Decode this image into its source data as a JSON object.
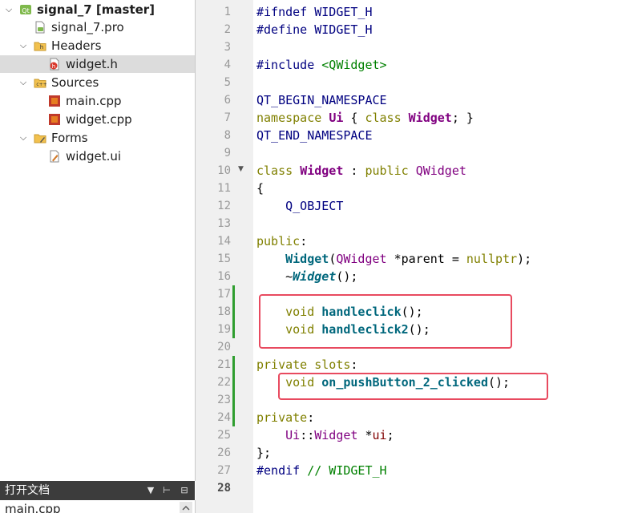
{
  "project_tree": {
    "root": {
      "label": "signal_7 [master]"
    },
    "pro_file": {
      "label": "signal_7.pro"
    },
    "headers": {
      "label": "Headers",
      "files": [
        "widget.h"
      ]
    },
    "sources": {
      "label": "Sources",
      "files": [
        "main.cpp",
        "widget.cpp"
      ]
    },
    "forms": {
      "label": "Forms",
      "files": [
        "widget.ui"
      ]
    },
    "selected": "widget.h"
  },
  "open_documents": {
    "title": "打开文档",
    "items": [
      "main.cpp"
    ]
  },
  "editor": {
    "current_line": 28,
    "line_numbers": [
      "1",
      "2",
      "3",
      "4",
      "5",
      "6",
      "7",
      "8",
      "9",
      "10",
      "11",
      "12",
      "13",
      "14",
      "15",
      "16",
      "17",
      "18",
      "19",
      "20",
      "21",
      "22",
      "23",
      "24",
      "25",
      "26",
      "27",
      "28"
    ],
    "lines": [
      [
        {
          "t": "#ifndef WIDGET_H",
          "c": "pp"
        }
      ],
      [
        {
          "t": "#define WIDGET_H",
          "c": "pp"
        }
      ],
      [],
      [
        {
          "t": "#include ",
          "c": "pp"
        },
        {
          "t": "<QWidget>",
          "c": "st"
        }
      ],
      [],
      [
        {
          "t": "QT_BEGIN_NAMESPACE",
          "c": "df"
        }
      ],
      [
        {
          "t": "namespace ",
          "c": "kw"
        },
        {
          "t": "Ui",
          "c": "ty"
        },
        {
          "t": " { ",
          "c": ""
        },
        {
          "t": "class ",
          "c": "kw"
        },
        {
          "t": "Widget",
          "c": "ty"
        },
        {
          "t": "; }",
          "c": ""
        }
      ],
      [
        {
          "t": "QT_END_NAMESPACE",
          "c": "df"
        }
      ],
      [],
      [
        {
          "t": "class ",
          "c": "kw"
        },
        {
          "t": "Widget",
          "c": "ty"
        },
        {
          "t": " : ",
          "c": ""
        },
        {
          "t": "public ",
          "c": "kw"
        },
        {
          "t": "QWidget",
          "c": "ty2"
        }
      ],
      [
        {
          "t": "{",
          "c": ""
        }
      ],
      [
        {
          "t": "    ",
          "c": ""
        },
        {
          "t": "Q_OBJECT",
          "c": "df"
        }
      ],
      [],
      [
        {
          "t": "public",
          "c": "kw"
        },
        {
          "t": ":",
          "c": ""
        }
      ],
      [
        {
          "t": "    ",
          "c": ""
        },
        {
          "t": "Widget",
          "c": "fn"
        },
        {
          "t": "(",
          "c": ""
        },
        {
          "t": "QWidget",
          "c": "ty2"
        },
        {
          "t": " *parent = ",
          "c": ""
        },
        {
          "t": "nullptr",
          "c": "kw"
        },
        {
          "t": ");",
          "c": ""
        }
      ],
      [
        {
          "t": "    ~",
          "c": ""
        },
        {
          "t": "Widget",
          "c": "fi"
        },
        {
          "t": "();",
          "c": ""
        }
      ],
      [],
      [
        {
          "t": "    ",
          "c": ""
        },
        {
          "t": "void ",
          "c": "kw"
        },
        {
          "t": "handleclick",
          "c": "fn"
        },
        {
          "t": "();",
          "c": ""
        }
      ],
      [
        {
          "t": "    ",
          "c": ""
        },
        {
          "t": "void ",
          "c": "kw"
        },
        {
          "t": "handleclick2",
          "c": "fn"
        },
        {
          "t": "();",
          "c": ""
        }
      ],
      [],
      [
        {
          "t": "private ",
          "c": "kw"
        },
        {
          "t": "slots",
          "c": "kw"
        },
        {
          "t": ":",
          "c": ""
        }
      ],
      [
        {
          "t": "    ",
          "c": ""
        },
        {
          "t": "void ",
          "c": "kw"
        },
        {
          "t": "on_pushButton_2_clicked",
          "c": "fn"
        },
        {
          "t": "();",
          "c": ""
        }
      ],
      [],
      [
        {
          "t": "private",
          "c": "kw"
        },
        {
          "t": ":",
          "c": ""
        }
      ],
      [
        {
          "t": "    ",
          "c": ""
        },
        {
          "t": "Ui",
          "c": "ty2"
        },
        {
          "t": "::",
          "c": ""
        },
        {
          "t": "Widget",
          "c": "ty2"
        },
        {
          "t": " *",
          "c": ""
        },
        {
          "t": "ui",
          "c": "mb"
        },
        {
          "t": ";",
          "c": ""
        }
      ],
      [
        {
          "t": "};",
          "c": ""
        }
      ],
      [
        {
          "t": "#endif ",
          "c": "pp"
        },
        {
          "t": "// WIDGET_H",
          "c": "cm"
        }
      ],
      []
    ],
    "fold_marker_line": 10,
    "changed_lines": [
      17,
      18,
      19,
      21,
      22,
      23,
      24
    ],
    "highlight_color": "#e84a5f",
    "change_bar_color": "#2f9e2f"
  }
}
